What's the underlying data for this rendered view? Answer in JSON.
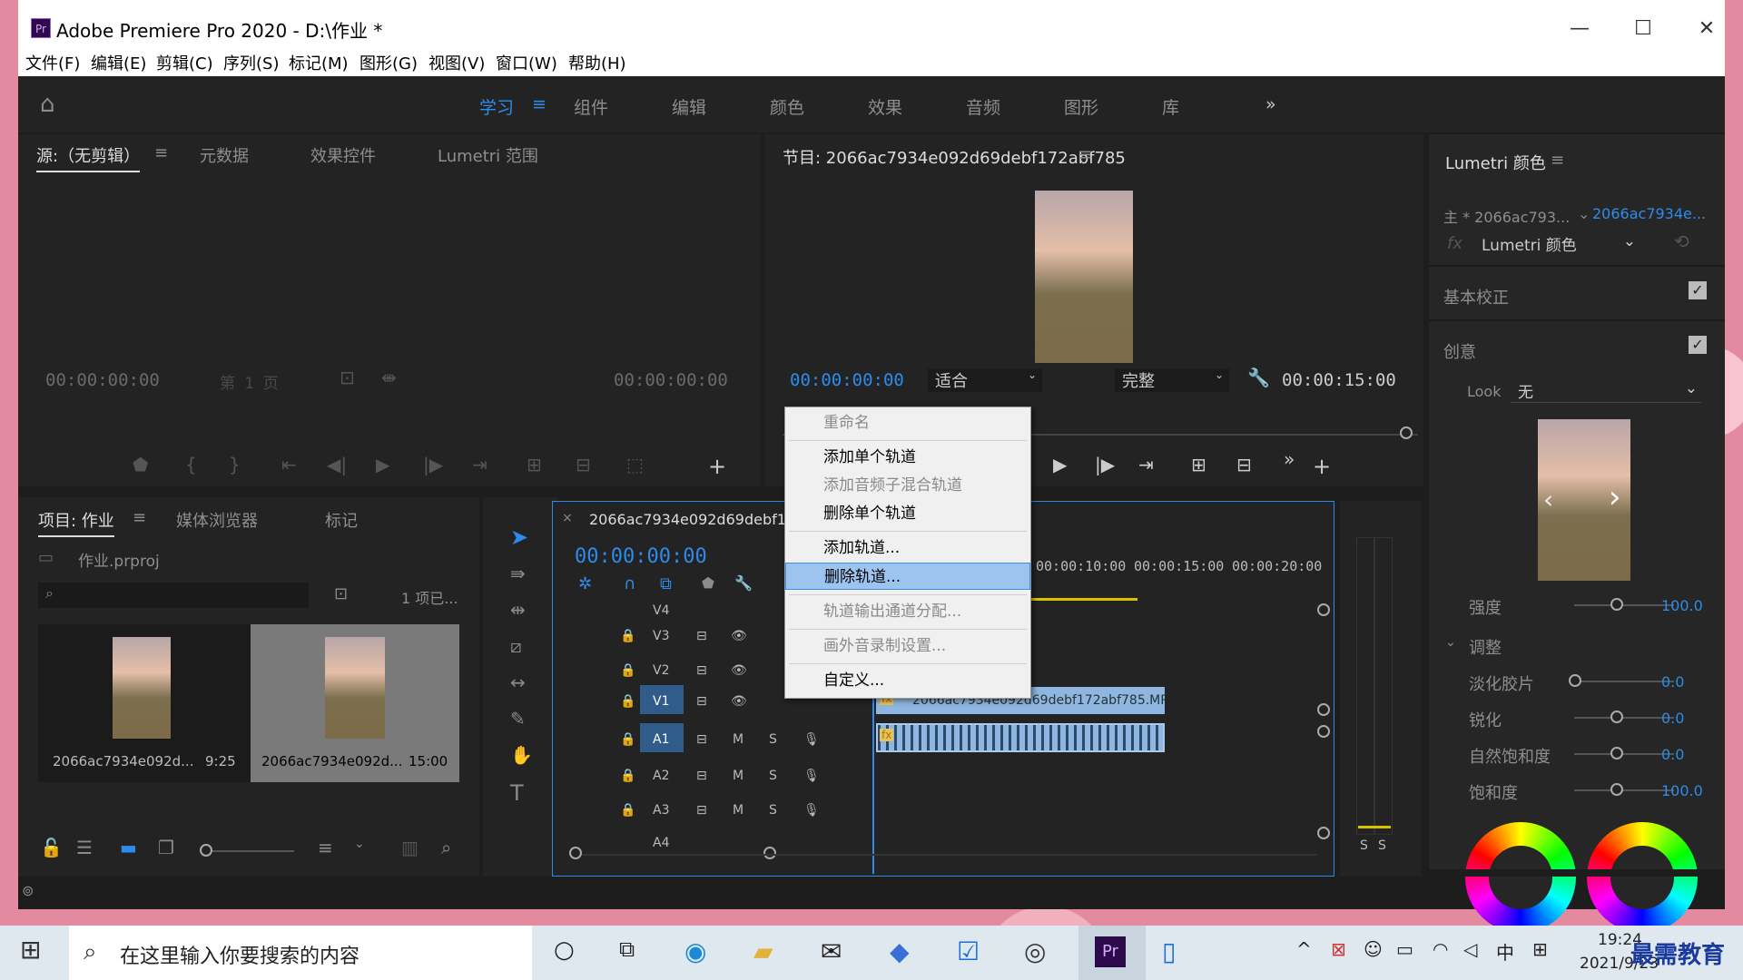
{
  "window": {
    "title": "Adobe Premiere Pro 2020 - D:\\作业 *",
    "logo": "Pr"
  },
  "menu": [
    "文件(F)",
    "编辑(E)",
    "剪辑(C)",
    "序列(S)",
    "标记(M)",
    "图形(G)",
    "视图(V)",
    "窗口(W)",
    "帮助(H)"
  ],
  "workspaces": [
    "学习",
    "组件",
    "编辑",
    "颜色",
    "效果",
    "音频",
    "图形",
    "库"
  ],
  "source_panel": {
    "tabs": [
      "源:（无剪辑）",
      "元数据",
      "效果控件",
      "Lumetri 范围"
    ],
    "tc_left": "00:00:00:00",
    "page": "第 1 页",
    "tc_right": "00:00:00:00"
  },
  "program_panel": {
    "title": "节目: 2066ac7934e092d69debf172abf785",
    "tc_current": "00:00:00:00",
    "fit": "适合",
    "quality": "完整",
    "tc_duration": "00:00:15:00"
  },
  "lumetri": {
    "title": "Lumetri 颜色",
    "master": "主 * 2066ac793...",
    "clip": "2066ac7934e...",
    "fx_select": "Lumetri 颜色",
    "basic": "基本校正",
    "creative": "创意",
    "look_label": "Look",
    "look_value": "无",
    "intensity_label": "强度",
    "intensity_value": "100.0",
    "adjust": "调整",
    "sliders": [
      {
        "label": "淡化胶片",
        "value": "0.0"
      },
      {
        "label": "锐化",
        "value": "0.0"
      },
      {
        "label": "自然饱和度",
        "value": "0.0"
      },
      {
        "label": "饱和度",
        "value": "100.0"
      }
    ]
  },
  "project_panel": {
    "tabs": [
      "项目: 作业",
      "媒体浏览器",
      "标记"
    ],
    "file": "作业.prproj",
    "count": "1 项已...",
    "items": [
      {
        "name": "2066ac7934e092d...",
        "duration": "9:25"
      },
      {
        "name": "2066ac7934e092d...",
        "duration": "15:00"
      }
    ]
  },
  "timeline": {
    "tab": "2066ac7934e092d69debf172",
    "tc": "00:00:00:00",
    "ruler": [
      "00:00:10:00",
      "00:00:15:00",
      "00:00:20:00"
    ],
    "video_tracks": [
      "V4",
      "V3",
      "V2",
      "V1"
    ],
    "audio_tracks": [
      "A1",
      "A2",
      "A3",
      "A4"
    ],
    "clip_name": "2066ac7934e092d69debf172abf785.MP4 [V]",
    "fx": "fx",
    "m": "M",
    "s": "S"
  },
  "meters": {
    "s1": "S",
    "s2": "S"
  },
  "context_menu": [
    {
      "label": "重命名",
      "disabled": true
    },
    {
      "label": "添加单个轨道",
      "disabled": false
    },
    {
      "label": "添加音频子混合轨道",
      "disabled": true
    },
    {
      "label": "删除单个轨道",
      "disabled": false
    },
    {
      "label": "添加轨道...",
      "disabled": false
    },
    {
      "label": "删除轨道...",
      "disabled": false,
      "highlight": true
    },
    {
      "label": "轨道输出通道分配...",
      "disabled": true
    },
    {
      "label": "画外音录制设置...",
      "disabled": true
    },
    {
      "label": "自定义...",
      "disabled": false
    }
  ],
  "taskbar": {
    "search_placeholder": "在这里输入你要搜索的内容",
    "time": "19:24",
    "date": "2021/9/23",
    "ime": "中",
    "watermark": "最需教育"
  }
}
